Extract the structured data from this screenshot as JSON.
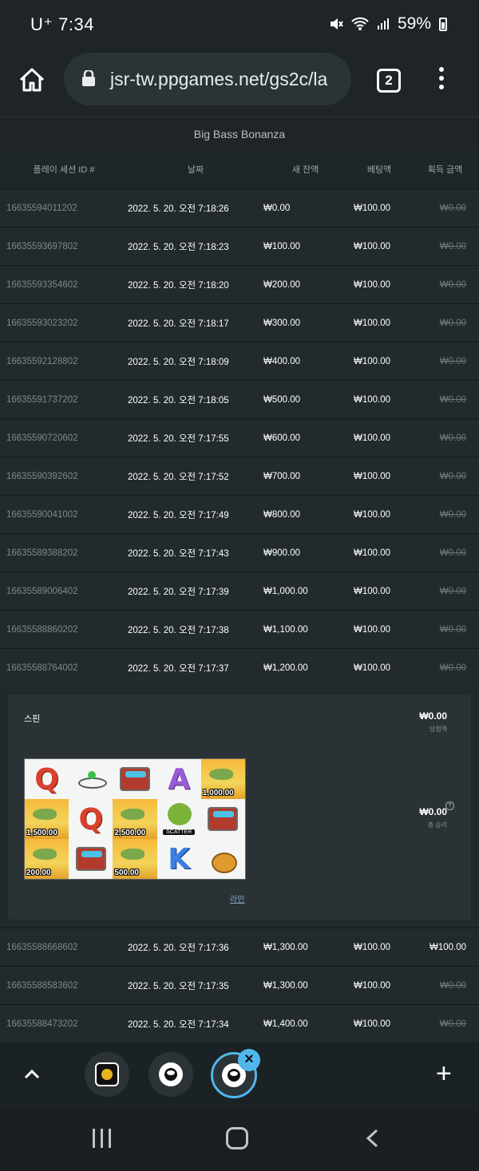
{
  "status": {
    "carrier": "U⁺",
    "time": "7:34",
    "battery": "59%"
  },
  "browser": {
    "url": "jsr-tw.ppgames.net/gs2c/la",
    "tab_count": "2"
  },
  "game_title": "Big Bass Bonanza",
  "table": {
    "headers": [
      "플레이 세션 ID #",
      "날짜",
      "새 잔액",
      "베팅액",
      "획득 금액"
    ],
    "rows_top": [
      [
        "16635594011202",
        "2022. 5. 20. 오전 7:18:26",
        "₩0.00",
        "₩100.00",
        "₩0.00"
      ],
      [
        "16635593697802",
        "2022. 5. 20. 오전 7:18:23",
        "₩100.00",
        "₩100.00",
        "₩0.00"
      ],
      [
        "16635593354602",
        "2022. 5. 20. 오전 7:18:20",
        "₩200.00",
        "₩100.00",
        "₩0.00"
      ],
      [
        "16635593023202",
        "2022. 5. 20. 오전 7:18:17",
        "₩300.00",
        "₩100.00",
        "₩0.00"
      ],
      [
        "16635592128802",
        "2022. 5. 20. 오전 7:18:09",
        "₩400.00",
        "₩100.00",
        "₩0.00"
      ],
      [
        "16635591737202",
        "2022. 5. 20. 오전 7:18:05",
        "₩500.00",
        "₩100.00",
        "₩0.00"
      ],
      [
        "16635590720602",
        "2022. 5. 20. 오전 7:17:55",
        "₩600.00",
        "₩100.00",
        "₩0.00"
      ],
      [
        "16635590392602",
        "2022. 5. 20. 오전 7:17:52",
        "₩700.00",
        "₩100.00",
        "₩0.00"
      ],
      [
        "16635590041002",
        "2022. 5. 20. 오전 7:17:49",
        "₩800.00",
        "₩100.00",
        "₩0.00"
      ],
      [
        "16635589388202",
        "2022. 5. 20. 오전 7:17:43",
        "₩900.00",
        "₩100.00",
        "₩0.00"
      ],
      [
        "16635589006402",
        "2022. 5. 20. 오전 7:17:39",
        "₩1,000.00",
        "₩100.00",
        "₩0.00"
      ],
      [
        "16635588860202",
        "2022. 5. 20. 오전 7:17:38",
        "₩1,100.00",
        "₩100.00",
        "₩0.00"
      ],
      [
        "16635588764002",
        "2022. 5. 20. 오전 7:17:37",
        "₩1,200.00",
        "₩100.00",
        "₩0.00"
      ]
    ],
    "rows_bottom": [
      [
        "16635588668602",
        "2022. 5. 20. 오전 7:17:36",
        "₩1,300.00",
        "₩100.00",
        "₩100.00"
      ],
      [
        "16635588583602",
        "2022. 5. 20. 오전 7:17:35",
        "₩1,300.00",
        "₩100.00",
        "₩0.00"
      ],
      [
        "16635588473202",
        "2022. 5. 20. 오전 7:17:34",
        "₩1,400.00",
        "₩100.00",
        "₩0.00"
      ]
    ]
  },
  "spin": {
    "label": "스핀",
    "win_amount": "₩0.00",
    "win_label": "당첨액",
    "total_win": "₩0.00",
    "total_label": "총 승리",
    "help": "?",
    "line_link": "라인",
    "scatter_text": "SCATTER",
    "money_values": [
      "1,000.00",
      "1,500.00",
      "2,500.00",
      "200.00",
      "500.00"
    ]
  },
  "tabbar": {
    "close": "×",
    "plus": "+"
  }
}
